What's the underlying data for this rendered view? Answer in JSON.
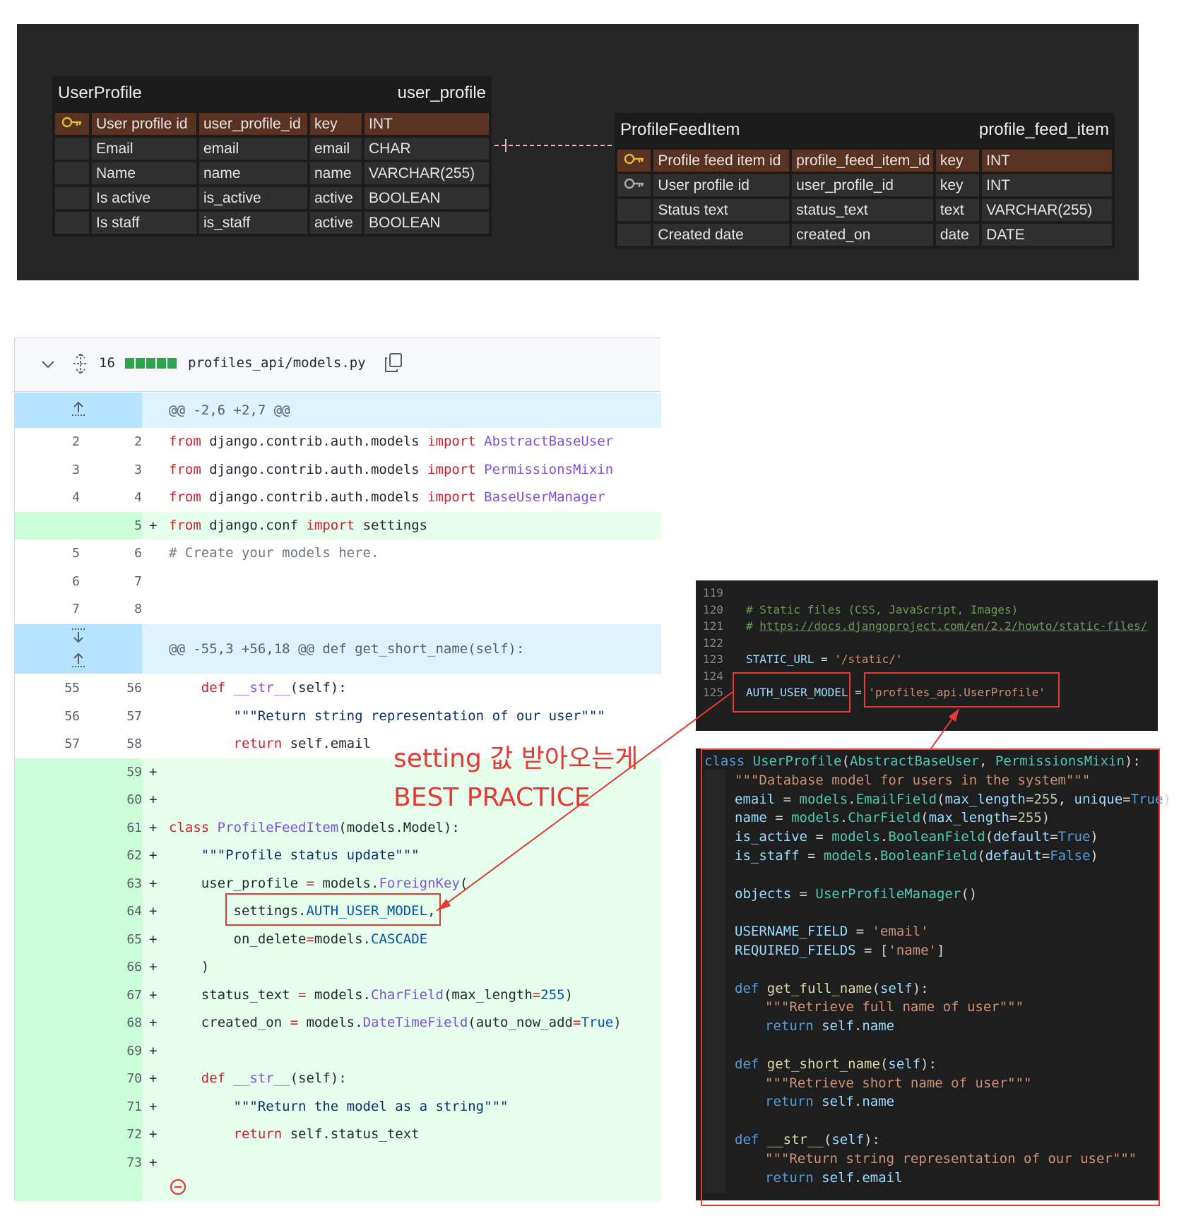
{
  "er": {
    "user_profile": {
      "title": "UserProfile",
      "table": "user_profile",
      "rows": [
        {
          "label": "User profile id",
          "column": "user_profile_id",
          "kind": "key",
          "type": "INT",
          "pk": true
        },
        {
          "label": "Email",
          "column": "email",
          "kind": "email",
          "type": "CHAR"
        },
        {
          "label": "Name",
          "column": "name",
          "kind": "name",
          "type": "VARCHAR(255)"
        },
        {
          "label": "Is active",
          "column": "is_active",
          "kind": "active",
          "type": "BOOLEAN"
        },
        {
          "label": "Is staff",
          "column": "is_staff",
          "kind": "active",
          "type": "BOOLEAN"
        }
      ]
    },
    "profile_feed_item": {
      "title": "ProfileFeedItem",
      "table": "profile_feed_item",
      "rows": [
        {
          "label": "Profile feed item id",
          "column": "profile_feed_item_id",
          "kind": "key",
          "type": "INT",
          "pk": true
        },
        {
          "label": "User profile id",
          "column": "user_profile_id",
          "kind": "key",
          "type": "INT"
        },
        {
          "label": "Status text",
          "column": "status_text",
          "kind": "text",
          "type": "VARCHAR(255)"
        },
        {
          "label": "Created date",
          "column": "created_on",
          "kind": "date",
          "type": "DATE"
        }
      ]
    }
  },
  "diff": {
    "changes": "16",
    "filename": "profiles_api/models.py",
    "hunk1": "@@ -2,6 +2,7 @@",
    "hunk2": "@@ -55,3 +56,18 @@ def get_short_name(self):",
    "lines": [
      {
        "t": "ctx",
        "o": "2",
        "n": "2",
        "code": "<span class='k'>from</span> django.contrib.auth.models <span class='k'>import</span> <span class='f'>AbstractBaseUser</span>"
      },
      {
        "t": "ctx",
        "o": "3",
        "n": "3",
        "code": "<span class='k'>from</span> django.contrib.auth.models <span class='k'>import</span> <span class='f'>PermissionsMixin</span>"
      },
      {
        "t": "ctx",
        "o": "4",
        "n": "4",
        "code": "<span class='k'>from</span> django.contrib.auth.models <span class='k'>import</span> <span class='f'>BaseUserManager</span>"
      },
      {
        "t": "add",
        "o": "",
        "n": "5",
        "code": "<span class='k'>from</span> django.conf <span class='k'>import</span> settings"
      },
      {
        "t": "ctx",
        "o": "5",
        "n": "6",
        "code": "<span class='c'># Create your models here.</span>"
      },
      {
        "t": "ctx",
        "o": "6",
        "n": "7",
        "code": ""
      },
      {
        "t": "ctx",
        "o": "7",
        "n": "8",
        "code": ""
      }
    ],
    "lines2": [
      {
        "t": "ctx",
        "o": "55",
        "n": "56",
        "code": "    <span class='k'>def</span> <span class='f'>__str__</span>(self):"
      },
      {
        "t": "ctx",
        "o": "56",
        "n": "57",
        "code": "        <span class='s'>\"\"\"Return string representation of our user\"\"\"</span>"
      },
      {
        "t": "ctx",
        "o": "57",
        "n": "58",
        "code": "        <span class='k'>return</span> self.email"
      },
      {
        "t": "add",
        "o": "",
        "n": "59",
        "code": ""
      },
      {
        "t": "add",
        "o": "",
        "n": "60",
        "code": ""
      },
      {
        "t": "add",
        "o": "",
        "n": "61",
        "code": "<span class='k'>class</span> <span class='f'>ProfileFeedItem</span>(models.Model):"
      },
      {
        "t": "add",
        "o": "",
        "n": "62",
        "code": "    <span class='s'>\"\"\"Profile status update\"\"\"</span>"
      },
      {
        "t": "add",
        "o": "",
        "n": "63",
        "code": "    user_profile <span class='k'>=</span> models.<span class='f'>ForeignKey</span>("
      },
      {
        "t": "add",
        "o": "",
        "n": "64",
        "code": "        settings.<span class='n'>AUTH_USER_MODEL</span>,"
      },
      {
        "t": "add",
        "o": "",
        "n": "65",
        "code": "        on_delete<span class='k'>=</span>models.<span class='n'>CASCADE</span>"
      },
      {
        "t": "add",
        "o": "",
        "n": "66",
        "code": "    )"
      },
      {
        "t": "add",
        "o": "",
        "n": "67",
        "code": "    status_text <span class='k'>=</span> models.<span class='f'>CharField</span>(max_length<span class='k'>=</span><span class='n'>255</span>)"
      },
      {
        "t": "add",
        "o": "",
        "n": "68",
        "code": "    created_on <span class='k'>=</span> models.<span class='f'>DateTimeField</span>(auto_now_add<span class='k'>=</span><span class='n'>True</span>)"
      },
      {
        "t": "add",
        "o": "",
        "n": "69",
        "code": ""
      },
      {
        "t": "add",
        "o": "",
        "n": "70",
        "code": "    <span class='k'>def</span> <span class='f'>__str__</span>(self):"
      },
      {
        "t": "add",
        "o": "",
        "n": "71",
        "code": "        <span class='s'>\"\"\"Return the model as a string\"\"\"</span>"
      },
      {
        "t": "add",
        "o": "",
        "n": "72",
        "code": "        <span class='k'>return</span> self.status_text"
      },
      {
        "t": "add",
        "o": "",
        "n": "73",
        "code": ""
      }
    ]
  },
  "annotation": {
    "line1": "setting 값 받아오는게",
    "line2": "BEST PRACTICE"
  },
  "settings_code": [
    {
      "num": "119",
      "code": ""
    },
    {
      "num": "120",
      "code": "<span class='vc'># Static files (CSS, JavaScript, Images)</span>"
    },
    {
      "num": "121",
      "code": "<span class='vc'># <u>https://docs.djangoproject.com/en/2.2/howto/static-files/</u></span>"
    },
    {
      "num": "122",
      "code": ""
    },
    {
      "num": "123",
      "code": "<span class='vv'>STATIC_URL</span> = <span class='vs'>'/static/'</span>"
    },
    {
      "num": "124",
      "code": ""
    },
    {
      "num": "125",
      "code": "<span class='vv'>AUTH_USER_MODEL</span> = <span class='vs'>'profiles_api.UserProfile'</span>"
    }
  ],
  "class_code": [
    {
      "i": 0,
      "code": "<span class='vk'>class</span> <span class='vt'>UserProfile</span>(<span class='vt'>AbstractBaseUser</span>, <span class='vt'>PermissionsMixin</span>):"
    },
    {
      "i": 1,
      "code": "<span class='vs'>\"\"\"Database model for users in the system\"\"\"</span>"
    },
    {
      "i": 1,
      "code": "<span class='vv'>email</span> = <span class='vt'>models</span>.<span class='vt'>EmailField</span>(<span class='vv'>max_length</span>=<span class='vn'>255</span>, <span class='vv'>unique</span>=<span class='vk'>True</span>)"
    },
    {
      "i": 1,
      "code": "<span class='vv'>name</span> = <span class='vt'>models</span>.<span class='vt'>CharField</span>(<span class='vv'>max_length</span>=<span class='vn'>255</span>)"
    },
    {
      "i": 1,
      "code": "<span class='vv'>is_active</span> = <span class='vt'>models</span>.<span class='vt'>BooleanField</span>(<span class='vv'>default</span>=<span class='vk'>True</span>)"
    },
    {
      "i": 1,
      "code": "<span class='vv'>is_staff</span> = <span class='vt'>models</span>.<span class='vt'>BooleanField</span>(<span class='vv'>default</span>=<span class='vk'>False</span>)"
    },
    {
      "i": 1,
      "code": ""
    },
    {
      "i": 1,
      "code": "<span class='vv'>objects</span> = <span class='vt'>UserProfileManager</span>()"
    },
    {
      "i": 1,
      "code": ""
    },
    {
      "i": 1,
      "code": "<span class='vv'>USERNAME_FIELD</span> = <span class='vs'>'email'</span>"
    },
    {
      "i": 1,
      "code": "<span class='vv'>REQUIRED_FIELDS</span> = [<span class='vs'>'name'</span>]"
    },
    {
      "i": 1,
      "code": ""
    },
    {
      "i": 1,
      "code": "<span class='vk'>def</span> <span class='vf'>get_full_name</span>(<span class='vv'>self</span>):"
    },
    {
      "i": 2,
      "code": "<span class='vs'>\"\"\"Retrieve full name of user\"\"\"</span>"
    },
    {
      "i": 2,
      "code": "<span class='vk'>return</span> <span class='vv'>self</span>.<span class='vv'>name</span>"
    },
    {
      "i": 1,
      "code": ""
    },
    {
      "i": 1,
      "code": "<span class='vk'>def</span> <span class='vf'>get_short_name</span>(<span class='vv'>self</span>):"
    },
    {
      "i": 2,
      "code": "<span class='vs'>\"\"\"Retrieve short name of user\"\"\"</span>"
    },
    {
      "i": 2,
      "code": "<span class='vk'>return</span> <span class='vv'>self</span>.<span class='vv'>name</span>"
    },
    {
      "i": 1,
      "code": ""
    },
    {
      "i": 1,
      "code": "<span class='vk'>def</span> <span class='vf'>__str__</span>(<span class='vv'>self</span>):"
    },
    {
      "i": 2,
      "code": "<span class='vs'>\"\"\"Return string representation of our user\"\"\"</span>"
    },
    {
      "i": 2,
      "code": "<span class='vk'>return</span> <span class='vv'>self</span>.<span class='vv'>email</span>"
    }
  ],
  "colors": {
    "annotation_red": "#e53935",
    "er_background": "#262626",
    "er_pk_row": "#5a3222",
    "diff_add": "#e6ffec",
    "diff_hunk": "#ddf4ff",
    "editor_bg": "#1e1e1e"
  },
  "icons": [
    "key-icon",
    "chevron-down-icon",
    "expand-icon",
    "copy-icon",
    "expand-up-icon",
    "expand-down-icon",
    "comment-minus-icon"
  ]
}
